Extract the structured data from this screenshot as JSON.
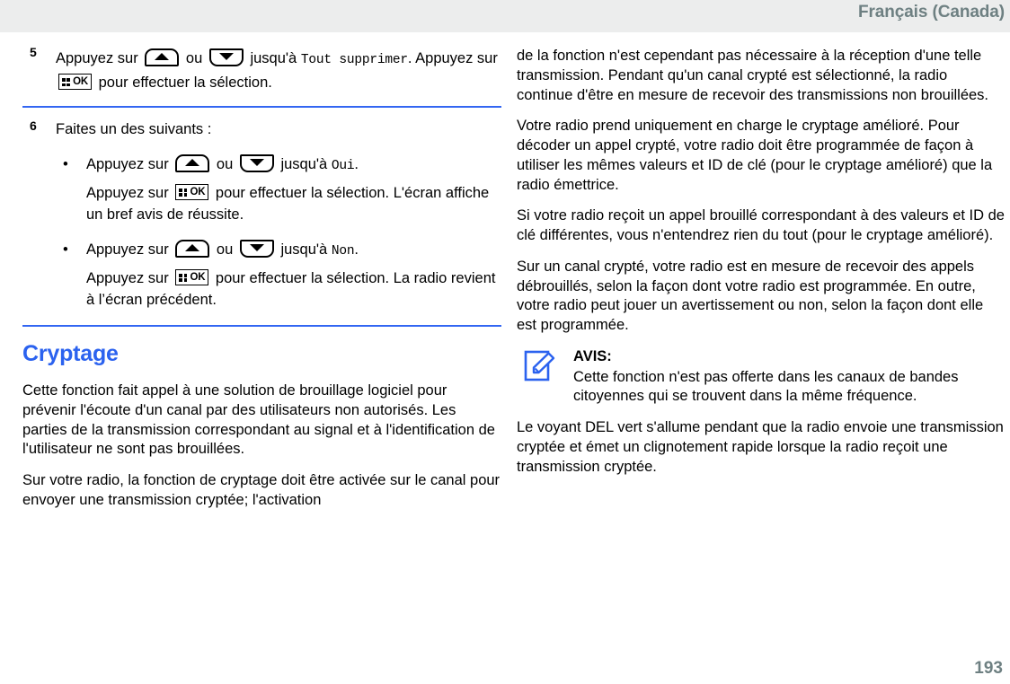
{
  "header": {
    "language": "Français (Canada)"
  },
  "footer": {
    "page_number": "193"
  },
  "colors": {
    "heading_blue": "#2b62ef",
    "rule_blue": "#3366f2",
    "header_text": "#6e8082",
    "header_band": "#eceded",
    "note_icon": "#2b62ef"
  },
  "icons": {
    "up_key": "arrow-up-key-icon",
    "down_key": "arrow-down-key-icon",
    "ok_key": "menu-ok-key-icon",
    "ok_label": "OK",
    "note": "notepad-pencil-icon"
  },
  "left_column": {
    "step5": {
      "number": "5",
      "t1": "Appuyez sur",
      "t2": "ou",
      "t3": "jusqu'à",
      "screen1": "Tout supprimer",
      "t4": ".",
      "t5": "Appuyez sur",
      "t6": "pour effectuer la sélection."
    },
    "step6": {
      "number": "6",
      "intro": "Faites un des suivants :",
      "bullets": [
        {
          "dot": "•",
          "t1": "Appuyez sur",
          "t2": "ou",
          "t3": "jusqu'à",
          "screen": "Oui",
          "t4": ".",
          "sub1": "Appuyez sur",
          "sub2": "pour effectuer la sélection. L'écran affiche un bref avis de réussite."
        },
        {
          "dot": "•",
          "t1": "Appuyez sur",
          "t2": "ou",
          "t3": "jusqu'à",
          "screen": "Non",
          "t4": ".",
          "sub1": "Appuyez sur",
          "sub2": "pour effectuer la sélection. La radio revient à l’écran précédent."
        }
      ]
    },
    "section": {
      "title": "Cryptage",
      "paragraphs": [
        "Cette fonction fait appel à une solution de brouillage logiciel pour prévenir l'écoute d'un canal par des utilisateurs non autorisés. Les parties de la transmission correspondant au signal et à l'identification de l'utilisateur ne sont pas brouillées.",
        "Sur votre radio, la fonction de cryptage doit être activée sur le canal pour envoyer une transmission cryptée; l'activation"
      ]
    }
  },
  "right_column": {
    "paragraphs_before_note": [
      "de la fonction n'est cependant pas nécessaire à la réception d'une telle transmission. Pendant qu'un canal crypté est sélectionné, la radio continue d'être en mesure de recevoir des transmissions non brouillées.",
      "Votre radio prend uniquement en charge le cryptage amélioré. Pour décoder un appel crypté, votre radio doit être programmée de façon à utiliser les mêmes valeurs et ID de clé (pour le cryptage amélioré) que la radio émettrice.",
      "Si votre radio reçoit un appel brouillé correspondant à des valeurs et ID de clé différentes, vous n'entendrez rien du tout (pour le cryptage amélioré).",
      "Sur un canal crypté, votre radio est en mesure de recevoir des appels débrouillés, selon la façon dont votre radio est programmée. En outre, votre radio peut jouer un avertissement ou non, selon la façon dont elle est programmée."
    ],
    "note": {
      "title": "AVIS:",
      "body": "Cette fonction n'est pas offerte dans les canaux de bandes citoyennes qui se trouvent dans la même fréquence."
    },
    "paragraphs_after_note": [
      "Le voyant DEL vert s'allume pendant que la radio envoie une transmission cryptée et émet un clignotement rapide lorsque la radio reçoit une transmission cryptée."
    ]
  }
}
